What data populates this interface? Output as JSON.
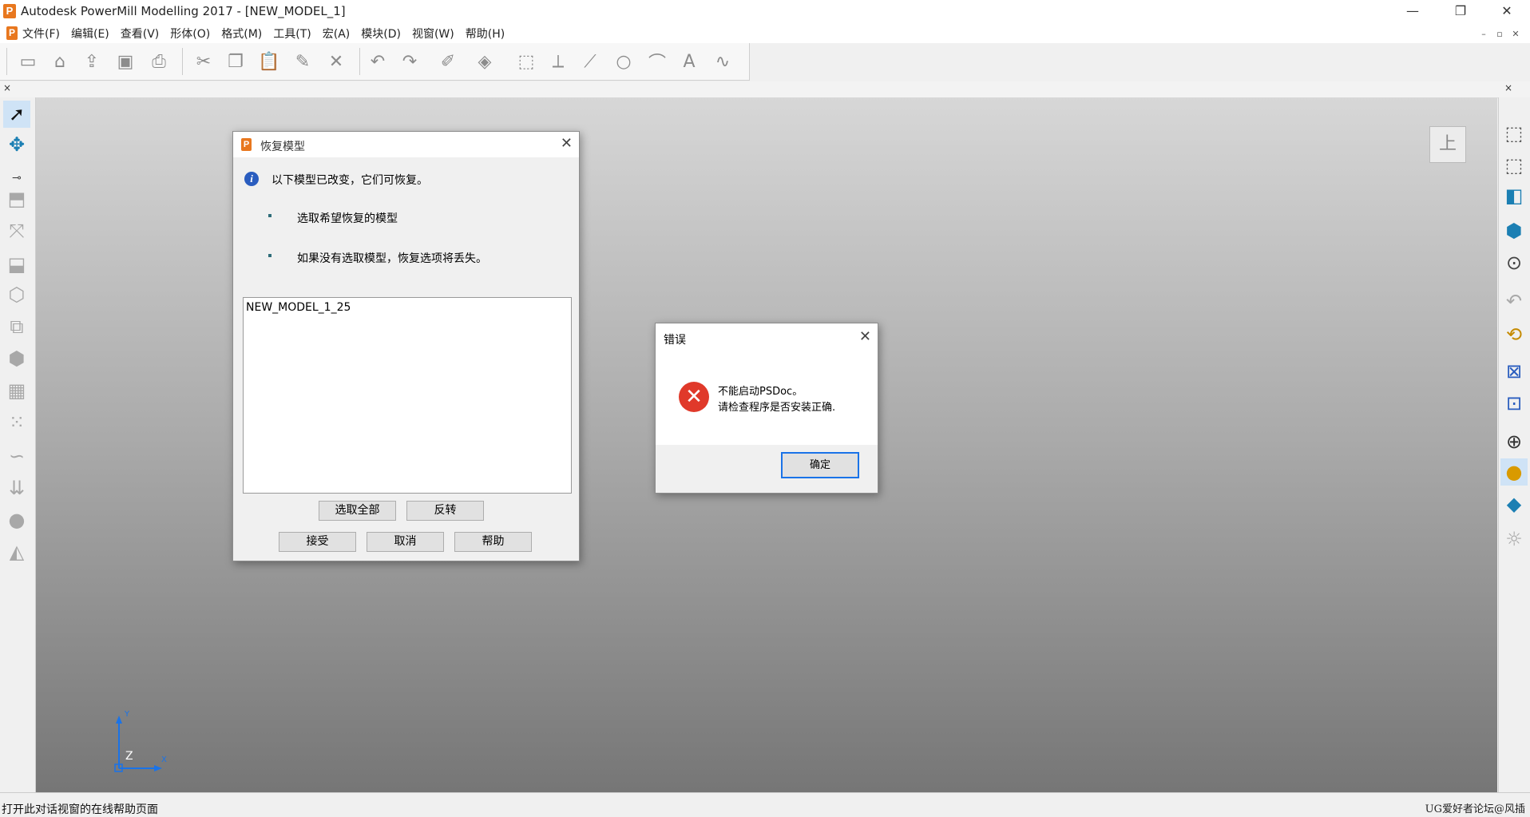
{
  "window": {
    "title": "Autodesk PowerMill Modelling 2017 - [NEW_MODEL_1]",
    "logo_letter": "P",
    "min_glyph": "—",
    "restore_glyph": "❐",
    "close_glyph": "✕"
  },
  "menu": {
    "items": [
      "文件(F)",
      "编辑(E)",
      "查看(V)",
      "形体(O)",
      "格式(M)",
      "工具(T)",
      "宏(A)",
      "模块(D)",
      "视窗(W)",
      "帮助(H)"
    ],
    "mdi_min": "–",
    "mdi_restore": "▫",
    "mdi_close": "✕"
  },
  "toolbar_icons": [
    "new-document-icon",
    "open-folder-icon",
    "import-icon",
    "save-icon",
    "print-icon",
    "cut-icon",
    "copy-icon",
    "paste-icon",
    "edit-pen-icon",
    "delete-icon",
    "undo-icon",
    "redo-icon",
    "sketch-icon",
    "shape-icon",
    "transform-icon",
    "axis-icon",
    "line-icon",
    "circle-icon",
    "arc-icon",
    "text-icon",
    "curve-icon"
  ],
  "strip_close": "×",
  "recover_dialog": {
    "title": "恢复模型",
    "info_text": "以下模型已改变，它们可恢复。",
    "bullets": [
      "选取希望恢复的模型",
      "如果没有选取模型，恢复选项将丢失。"
    ],
    "list_items": [
      "NEW_MODEL_1_25"
    ],
    "select_all": "选取全部",
    "invert": "反转",
    "accept": "接受",
    "cancel": "取消",
    "help": "帮助",
    "close_glyph": "✕"
  },
  "error_dialog": {
    "title": "错误",
    "line1": "不能启动PSDoc。",
    "line2": "请检查程序是否安装正确.",
    "ok": "确定",
    "close_glyph": "✕"
  },
  "viewport": {
    "view_cube_label": "上",
    "axis_labels": {
      "x": "X",
      "y": "Y",
      "z": "Z"
    }
  },
  "status": {
    "text": "打开此对话视窗的在线帮助页面",
    "watermark": "UG爱好者论坛@风插"
  },
  "colors": {
    "accent": "#e8771e",
    "error_red": "#e0392a",
    "info_blue": "#2a5dbf",
    "axis_blue": "#1a73e8"
  }
}
